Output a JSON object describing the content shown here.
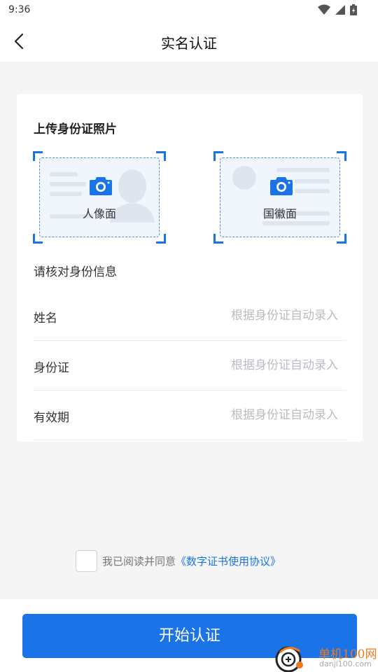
{
  "status_bar": {
    "time": "9:36"
  },
  "header": {
    "title": "实名认证"
  },
  "upload": {
    "title": "上传身份证照片",
    "front_label": "人像面",
    "back_label": "国徽面"
  },
  "verify": {
    "title": "请核对身份信息",
    "fields": [
      {
        "label": "姓名",
        "placeholder": "根据身份证自动录入"
      },
      {
        "label": "身份证",
        "placeholder": "根据身份证自动录入"
      },
      {
        "label": "有效期",
        "placeholder": "根据身份证自动录入"
      }
    ]
  },
  "agreement": {
    "checked": false,
    "text": "我已阅读并同意",
    "link": "《数字证书使用协议》"
  },
  "submit": {
    "label": "开始认证"
  },
  "watermark": {
    "title": "单机100网",
    "url": "danji100.com"
  },
  "colors": {
    "accent": "#1a74e8",
    "background": "#f5f5f6",
    "placeholder": "#b9bcc2"
  }
}
